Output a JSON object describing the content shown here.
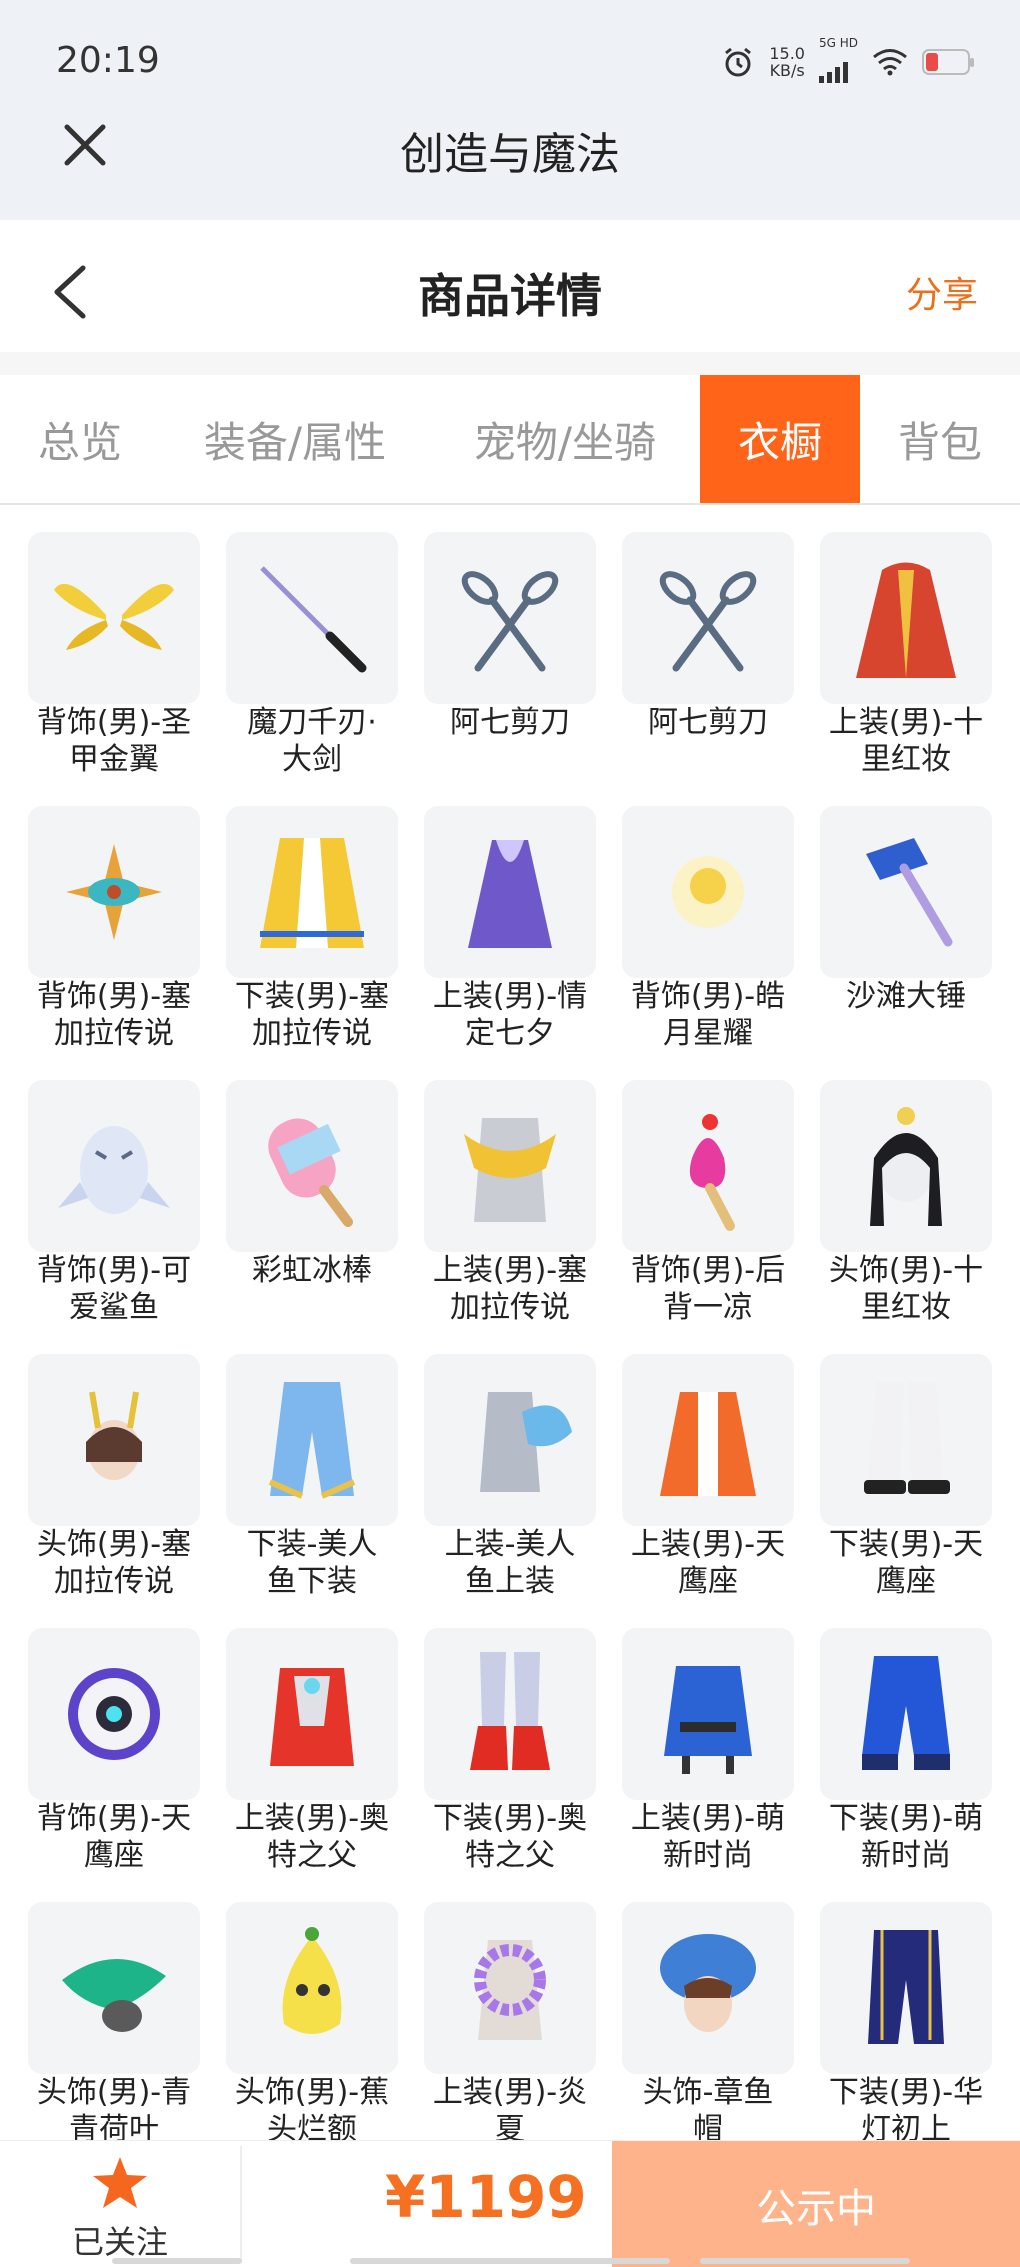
{
  "status_bar": {
    "time": "20:19",
    "net_speed_value": "15.0",
    "net_speed_unit": "KB/s",
    "signal_label": "5G HD",
    "battery_color": "#e94b4b"
  },
  "app": {
    "title": "创造与魔法"
  },
  "header": {
    "title": "商品详情",
    "share_label": "分享",
    "accent_color": "#e8711d"
  },
  "tabs": [
    {
      "label": "总览",
      "active": false
    },
    {
      "label": "装备/属性",
      "active": false
    },
    {
      "label": "宠物/坐骑",
      "active": false
    },
    {
      "label": "衣橱",
      "active": true
    },
    {
      "label": "背包",
      "active": false
    }
  ],
  "items": [
    {
      "line1": "背饰(男)-圣",
      "line2": "甲金翼",
      "icon": "golden-wings"
    },
    {
      "line1": "魔刀千刃·",
      "line2": "大剑",
      "icon": "black-sword"
    },
    {
      "line1": "阿七剪刀",
      "line2": "",
      "icon": "scissors"
    },
    {
      "line1": "阿七剪刀",
      "line2": "",
      "icon": "scissors"
    },
    {
      "line1": "上装(男)-十",
      "line2": "里红妆",
      "icon": "red-robe"
    },
    {
      "line1": "背饰(男)-塞",
      "line2": "加拉传说",
      "icon": "golden-eye-ornament"
    },
    {
      "line1": "下装(男)-塞",
      "line2": "加拉传说",
      "icon": "golden-skirt"
    },
    {
      "line1": "上装(男)-情",
      "line2": "定七夕",
      "icon": "purple-outfit"
    },
    {
      "line1": "背饰(男)-皓",
      "line2": "月星耀",
      "icon": "glowing-orb"
    },
    {
      "line1": "沙滩大锤",
      "line2": "",
      "icon": "hammer"
    },
    {
      "line1": "背饰(男)-可",
      "line2": "爱鲨鱼",
      "icon": "shark"
    },
    {
      "line1": "彩虹冰棒",
      "line2": "",
      "icon": "rainbow-popsicle"
    },
    {
      "line1": "上装(男)-塞",
      "line2": "加拉传说",
      "icon": "golden-collar"
    },
    {
      "line1": "背饰(男)-后",
      "line2": "背一凉",
      "icon": "ice-cream"
    },
    {
      "line1": "头饰(男)-十",
      "line2": "里红妆",
      "icon": "black-hair"
    },
    {
      "line1": "头饰(男)-塞",
      "line2": "加拉传说",
      "icon": "crowned-head"
    },
    {
      "line1": "下装-美人",
      "line2": "鱼下装",
      "icon": "blue-pants"
    },
    {
      "line1": "上装-美人",
      "line2": "鱼上装",
      "icon": "blue-fin-top"
    },
    {
      "line1": "上装(男)-天",
      "line2": "鹰座",
      "icon": "orange-jacket"
    },
    {
      "line1": "下装(男)-天",
      "line2": "鹰座",
      "icon": "white-boots"
    },
    {
      "line1": "背饰(男)-天",
      "line2": "鹰座",
      "icon": "robot-backpack"
    },
    {
      "line1": "上装(男)-奥",
      "line2": "特之父",
      "icon": "red-hero-top"
    },
    {
      "line1": "下装(男)-奥",
      "line2": "特之父",
      "icon": "red-boots"
    },
    {
      "line1": "上装(男)-萌",
      "line2": "新时尚",
      "icon": "blue-robe"
    },
    {
      "line1": "下装(男)-萌",
      "line2": "新时尚",
      "icon": "blue-trousers"
    },
    {
      "line1": "头饰(男)-青",
      "line2": "青荷叶",
      "icon": "lotus-leaf"
    },
    {
      "line1": "头饰(男)-蕉",
      "line2": "头烂额",
      "icon": "banana-hat"
    },
    {
      "line1": "上装(男)-炎",
      "line2": "夏",
      "icon": "flower-lei"
    },
    {
      "line1": "头饰-章鱼",
      "line2": "帽",
      "icon": "octopus-hat"
    },
    {
      "line1": "下装(男)-华",
      "line2": "灯初上",
      "icon": "navy-pants"
    }
  ],
  "bottom": {
    "follow_label": "已关注",
    "price": "¥1199",
    "status_label": "公示中",
    "price_color": "#f57121",
    "status_color": "#ffb38a"
  }
}
